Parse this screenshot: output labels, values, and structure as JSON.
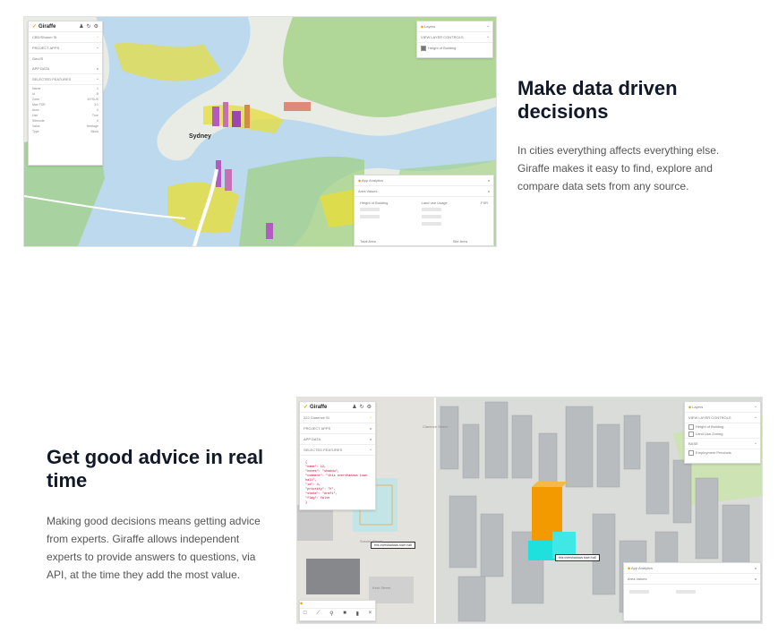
{
  "section1": {
    "heading": "Make data driven decisions",
    "body": "In cities everything affects everything else. Giraffe makes it easy to find, explore and compare data sets from any source.",
    "screenshot": {
      "brand": "Giraffe",
      "project_name": "CBD/Sharon St",
      "project_apps": "PROJECT APPS",
      "geojson": "GeoJS",
      "app_data": "APP DATA",
      "selected_features": "SELECTED FEATURES",
      "map_label": "Sydney",
      "layers_title": "Layers",
      "layers_group": "VIEW LAYER CONTROLS",
      "layers_item": "Height of Building",
      "analytics_title": "App Analytics",
      "analytics_sub": "Area Values",
      "analytics_col1": "Height of Building",
      "analytics_col2": "Land use Usage",
      "analytics_col3": "FSR",
      "analytics_footer1": "Total Area",
      "analytics_footer2": "Site Area",
      "props": [
        {
          "k": "Name",
          "v": "1"
        },
        {
          "k": "Id",
          "v": "B"
        },
        {
          "k": "Zone",
          "v": "MYSUS"
        },
        {
          "k": "Max FSR",
          "v": "3:1"
        },
        {
          "k": "Area",
          "v": "0"
        },
        {
          "k": "Use",
          "v": "True"
        },
        {
          "k": "Sitecode",
          "v": "0"
        },
        {
          "k": "Value",
          "v": "Heritage"
        },
        {
          "k": "Type",
          "v": "Block"
        }
      ],
      "colors": {
        "brand": "#f2a100",
        "water": "#bcd9ee",
        "land": "#e8ece4",
        "green": "#9fd07f",
        "yellow": "#e7dd38",
        "purple": "#b25bc0"
      }
    }
  },
  "section2": {
    "heading": "Get good advice in real time",
    "body": "Making good decisions means getting advice from experts. Giraffe allows independent experts to provide answers to questions, via API, at the time they add the most value.",
    "screenshot": {
      "brand": "Giraffe",
      "project_name": "222 Clarence St",
      "project_apps": "PROJECT APPS",
      "app_data": "APP DATA",
      "selected_features": "SELECTED FEATURES",
      "layers_title": "Layers",
      "layers_group": "VIEW LAYER CONTROLS",
      "layers_items": [
        "Height of Building",
        "Land Use Zoning"
      ],
      "layers_group2": "BASE",
      "layers_item3": "Employment Precincts",
      "analytics_title": "App Analytics",
      "analytics_sub": "Area Values",
      "tag_text": "this overshadows town hall",
      "street_labels": [
        "Sussex Street",
        "Kent Street",
        "Clarence Street"
      ],
      "json_snippet": [
        "{",
        "\"name\": 12,",
        "\"notes\": \"shadow\",",
        "\"comment\": \"this overshadows town hall\",",
        "\"id\": 4,",
        "\"priority\": \"h\",",
        "\"state\": \"draft\",",
        "\"flag\": false",
        "}"
      ],
      "colors": {
        "orange": "#f29a00",
        "cyan": "#1ee0dc",
        "building": "#b9bcbf",
        "ground": "#e9e7e2",
        "park": "#cde3b4"
      }
    }
  }
}
